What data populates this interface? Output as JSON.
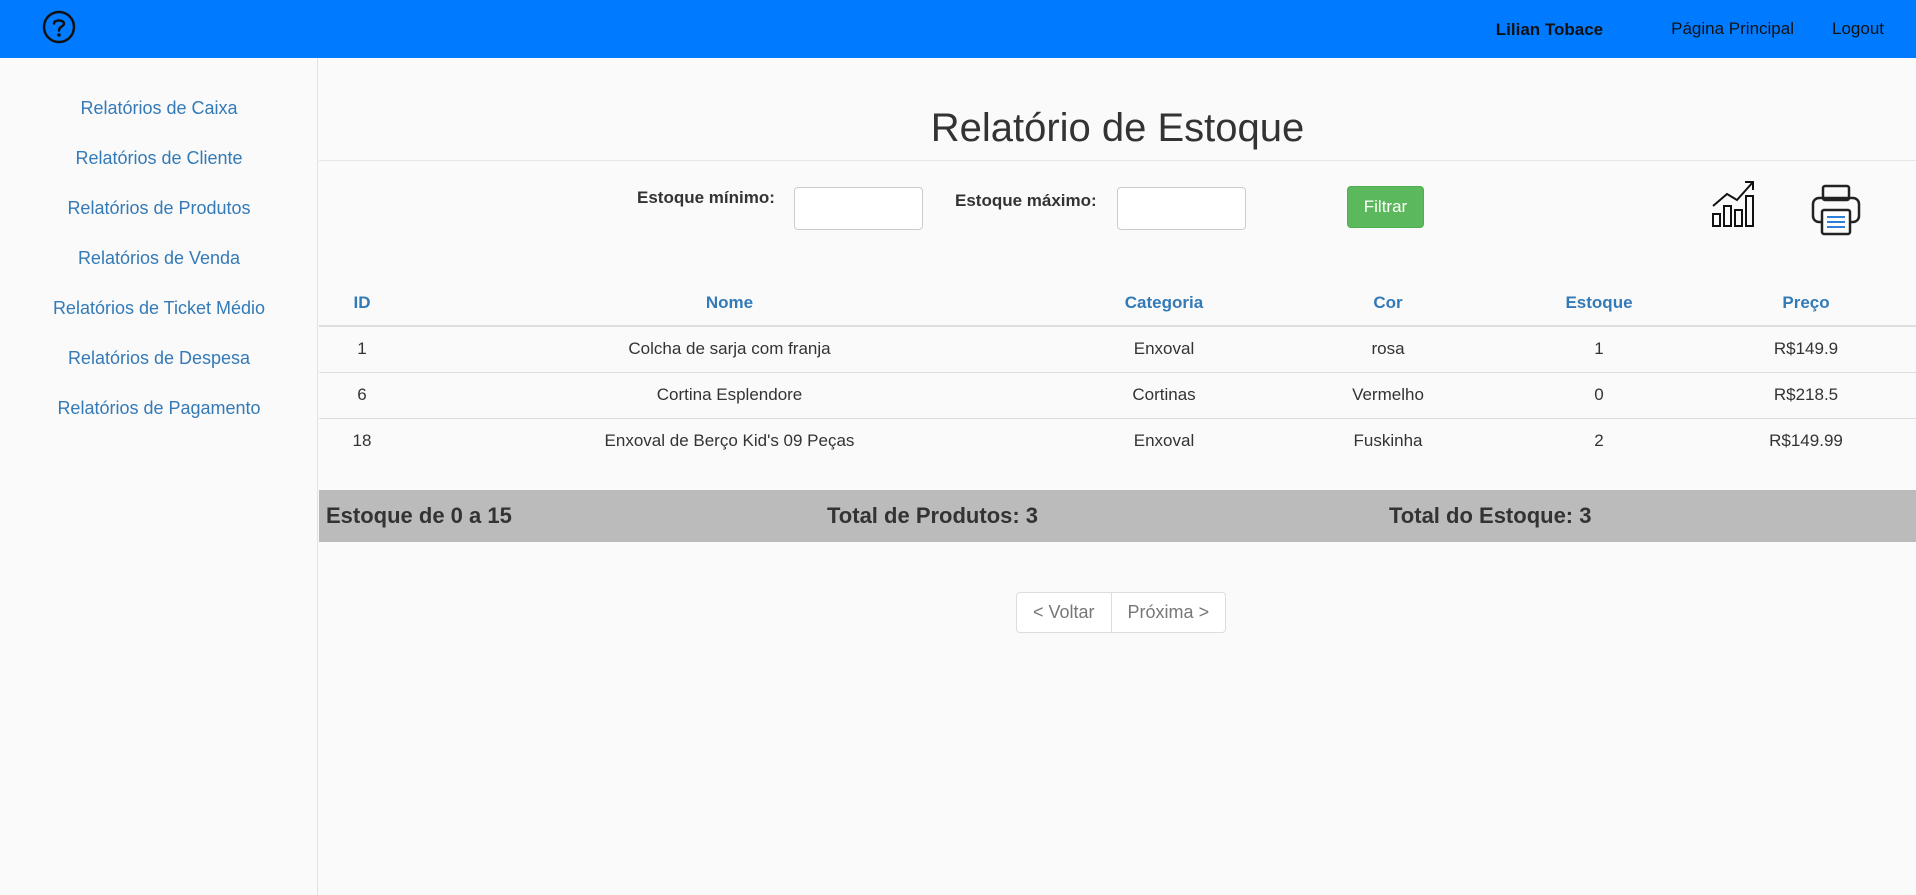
{
  "header": {
    "help_icon": "question-circle-icon",
    "user_name": "Lilian Tobace",
    "nav": [
      "Página Principal",
      "Logout"
    ]
  },
  "sidebar": {
    "items": [
      "Relatórios de Caixa",
      "Relatórios de Cliente",
      "Relatórios de Produtos",
      "Relatórios de Venda",
      "Relatórios de Ticket Médio",
      "Relatórios de Despesa",
      "Relatórios de Pagamento"
    ]
  },
  "main": {
    "title": "Relatório de Estoque",
    "filters": {
      "min_label": "Estoque mínimo:",
      "min_value": "",
      "max_label": "Estoque máximo:",
      "max_value": "",
      "button": "Filtrar"
    },
    "icons": {
      "chart": "chart-growth-icon",
      "print": "printer-icon"
    },
    "table": {
      "columns": [
        "ID",
        "Nome",
        "Categoria",
        "Cor",
        "Estoque",
        "Preço"
      ],
      "rows": [
        [
          "1",
          "Colcha de sarja com franja",
          "Enxoval",
          "rosa",
          "1",
          "R$149.9"
        ],
        [
          "6",
          "Cortina Esplendore",
          "Cortinas",
          "Vermelho",
          "0",
          "R$218.5"
        ],
        [
          "18",
          "Enxoval de Berço Kid's 09 Peças",
          "Enxoval",
          "Fuskinha",
          "2",
          "R$149.99"
        ]
      ]
    },
    "summary": {
      "range": "Estoque de 0 a 15",
      "total_products": "Total de Produtos: 3",
      "total_stock": "Total do Estoque: 3"
    },
    "pager": {
      "prev": "< Voltar",
      "next": "Próxima >"
    }
  },
  "colors": {
    "topbar": "#007bff",
    "link": "#337ab7",
    "filter_button": "#5cb85c",
    "summary_bar": "#bbbbbb"
  }
}
